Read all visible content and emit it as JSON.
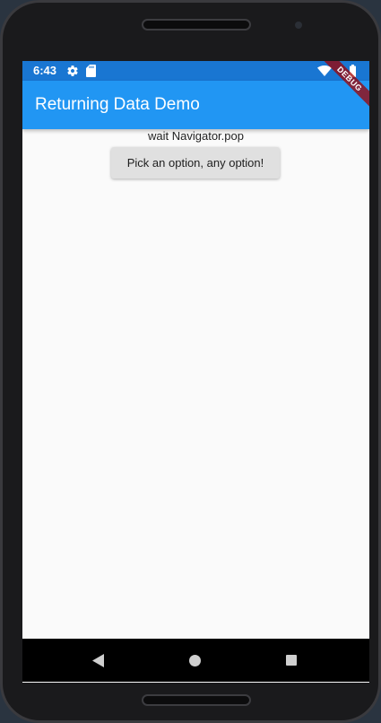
{
  "status_bar": {
    "time": "6:43",
    "icons": [
      "gear-icon",
      "sd-card-icon",
      "wifi-icon",
      "battery-icon"
    ]
  },
  "app_bar": {
    "title": "Returning Data Demo",
    "debug_label": "DEBUG"
  },
  "main": {
    "status_text": "wait Navigator.pop",
    "pick_button_label": "Pick an option, any option!"
  },
  "nav_bar": {
    "icons": [
      "back-icon",
      "home-icon",
      "recents-icon"
    ]
  },
  "colors": {
    "status_bar": "#1976d2",
    "app_bar": "#2196f3",
    "background": "#fafafa",
    "button": "#e0e0e0"
  }
}
